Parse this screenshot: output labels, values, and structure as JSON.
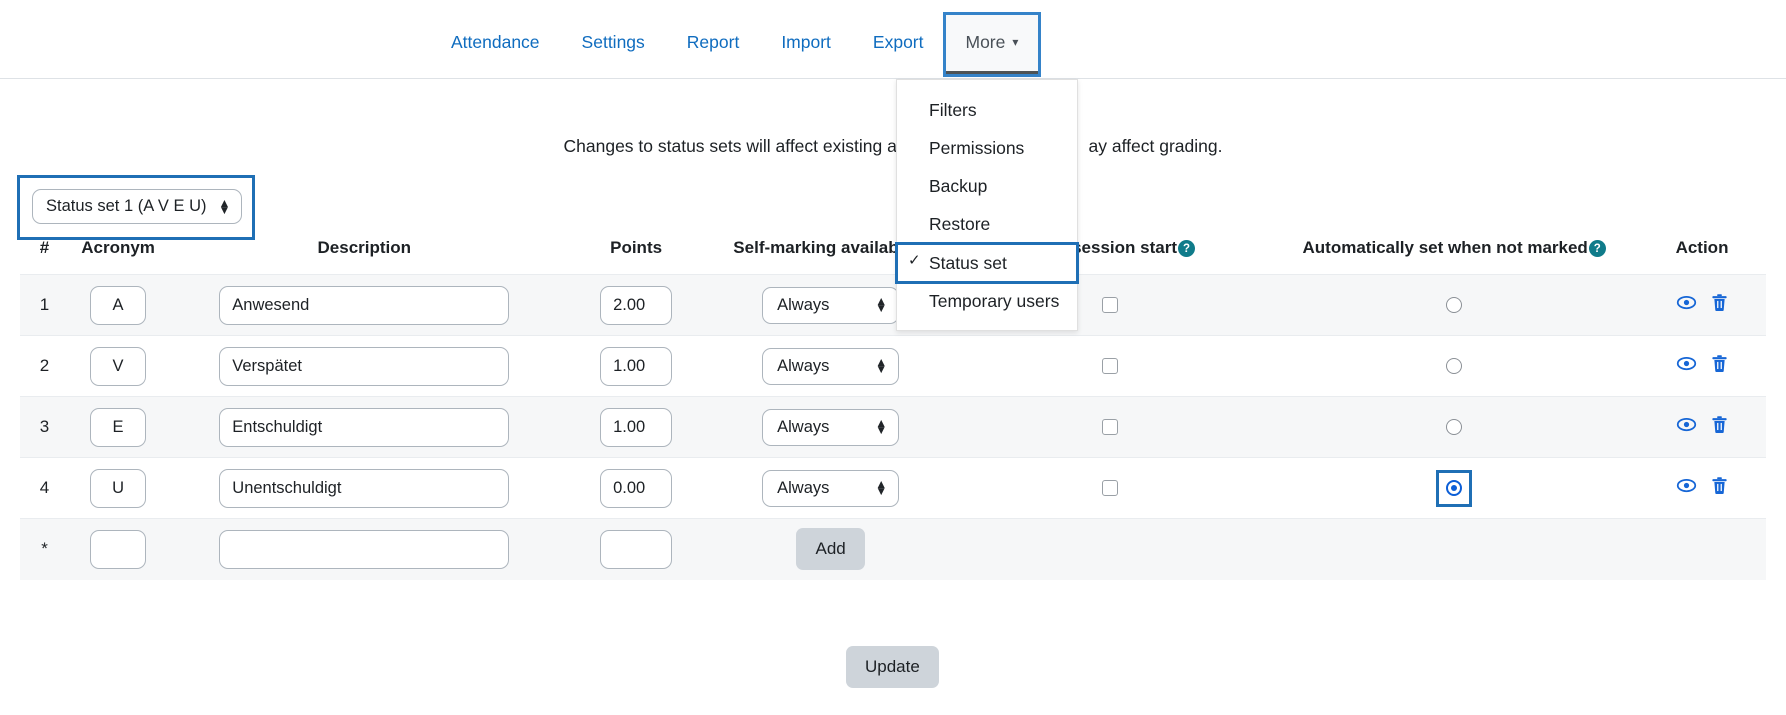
{
  "nav": {
    "links": [
      {
        "label": "Attendance",
        "name": "attendance"
      },
      {
        "label": "Settings",
        "name": "settings"
      },
      {
        "label": "Report",
        "name": "report"
      },
      {
        "label": "Import",
        "name": "import"
      },
      {
        "label": "Export",
        "name": "export"
      }
    ],
    "more_label": "More",
    "caret_icon": "chevron-down-icon",
    "active": "More"
  },
  "dropdown": {
    "open": true,
    "items": [
      {
        "label": "Filters",
        "checked": false,
        "highlighted": false
      },
      {
        "label": "Permissions",
        "checked": false,
        "highlighted": false
      },
      {
        "label": "Backup",
        "checked": false,
        "highlighted": false
      },
      {
        "label": "Restore",
        "checked": false,
        "highlighted": false
      },
      {
        "label": "Status set",
        "checked": true,
        "highlighted": true
      },
      {
        "label": "Temporary users",
        "checked": false,
        "highlighted": false
      }
    ]
  },
  "warning": {
    "text_left": "Changes to status sets will affect existing att",
    "text_right": "ay affect grading."
  },
  "status_set_select": {
    "value": "Status set 1 (A V E U)",
    "highlighted": true
  },
  "table": {
    "headers": [
      {
        "label": "#",
        "help": false
      },
      {
        "label": "Acronym",
        "help": false
      },
      {
        "label": "Description",
        "help": false
      },
      {
        "label": "Points",
        "help": false
      },
      {
        "label": "Self-marking availability",
        "help": false
      },
      {
        "label": "efore session start",
        "help": true
      },
      {
        "label": "Automatically set when not marked",
        "help": true
      },
      {
        "label": "Action",
        "help": false
      }
    ],
    "rows": [
      {
        "num": "1",
        "acronym": "A",
        "description": "Anwesend",
        "points": "2.00",
        "self_marking": "Always",
        "available_before": false,
        "auto_set": false,
        "auto_set_highlighted": false,
        "view_icon": "eye-icon",
        "delete_icon": "trash-icon"
      },
      {
        "num": "2",
        "acronym": "V",
        "description": "Verspätet",
        "points": "1.00",
        "self_marking": "Always",
        "available_before": false,
        "auto_set": false,
        "auto_set_highlighted": false,
        "view_icon": "eye-icon",
        "delete_icon": "trash-icon"
      },
      {
        "num": "3",
        "acronym": "E",
        "description": "Entschuldigt",
        "points": "1.00",
        "self_marking": "Always",
        "available_before": false,
        "auto_set": false,
        "auto_set_highlighted": false,
        "view_icon": "eye-icon",
        "delete_icon": "trash-icon"
      },
      {
        "num": "4",
        "acronym": "U",
        "description": "Unentschuldigt",
        "points": "0.00",
        "self_marking": "Always",
        "available_before": false,
        "auto_set": true,
        "auto_set_highlighted": true,
        "view_icon": "eye-icon",
        "delete_icon": "trash-icon"
      }
    ],
    "new_row": {
      "num": "*",
      "acronym": "",
      "description": "",
      "points": "",
      "add_label": "Add"
    }
  },
  "footer": {
    "update_label": "Update"
  },
  "colors": {
    "link": "#0f6cbf",
    "highlight": "#1f6fb5",
    "help_badge": "#0f7b8a",
    "icon_blue": "#0b5ed7",
    "button_bg": "#ced4da",
    "row_alt": "#f6f7f8"
  }
}
